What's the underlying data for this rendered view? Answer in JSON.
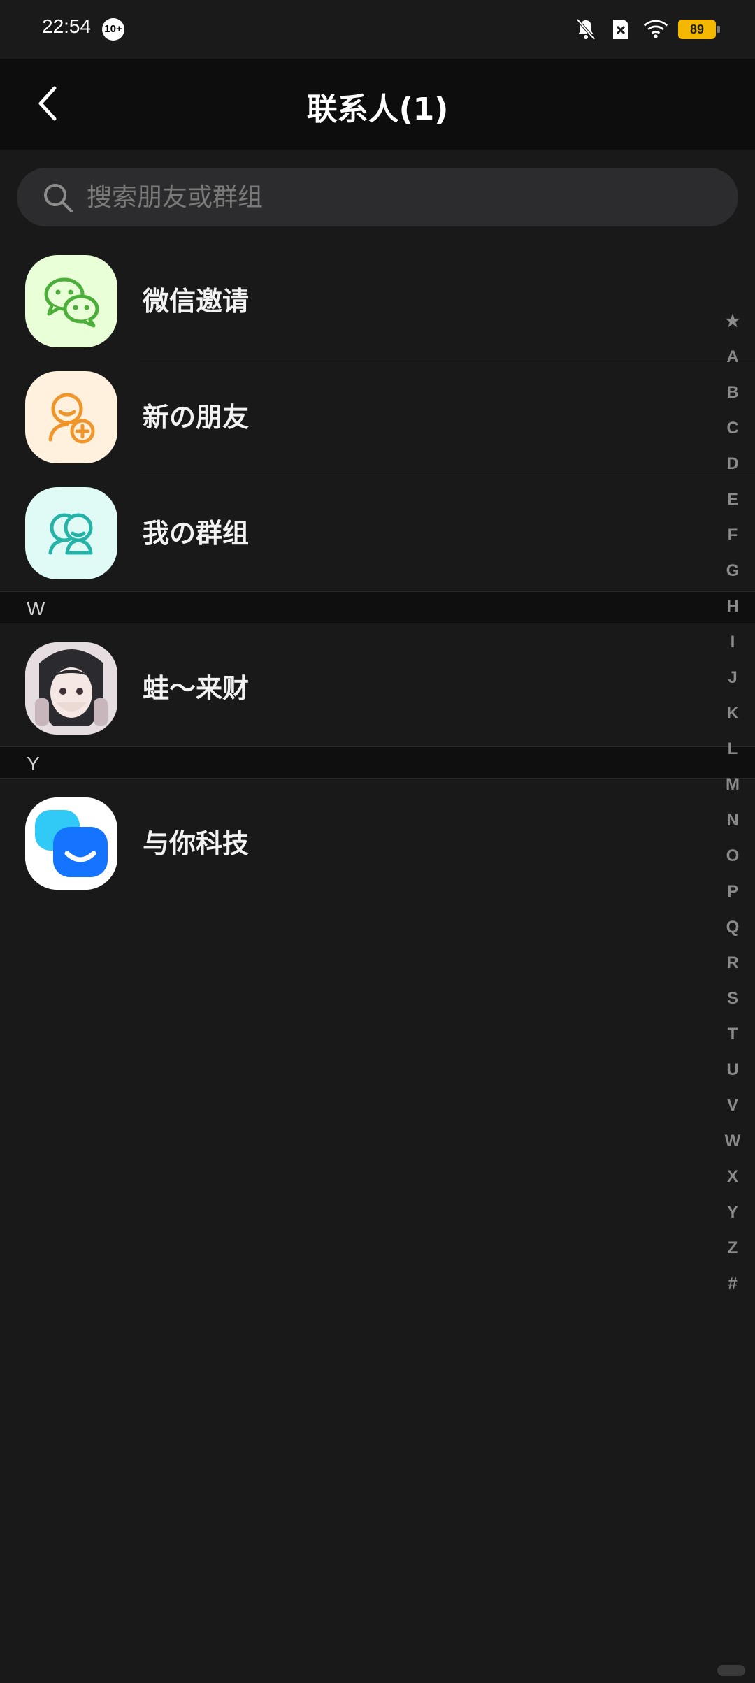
{
  "status_bar": {
    "time": "22:54",
    "notification_badge": "10+",
    "battery": "89",
    "icons": [
      "mute-bell-icon",
      "sim-x-icon",
      "wifi-icon",
      "battery-icon"
    ]
  },
  "header": {
    "title": "联系人(1)",
    "back_icon": "chevron-left-icon"
  },
  "search": {
    "placeholder": "搜索朋友或群组",
    "value": ""
  },
  "shortcuts": [
    {
      "label": "微信邀请",
      "icon": "wechat-icon",
      "color": "#4caf3a",
      "bg": "#e9ffd8"
    },
    {
      "label": "新の朋友",
      "icon": "add-friend-icon",
      "color": "#f0952a",
      "bg": "#fff1de"
    },
    {
      "label": "我の群组",
      "icon": "group-icon",
      "color": "#24b3a6",
      "bg": "#e0fbf6"
    }
  ],
  "sections": [
    {
      "letter": "W",
      "contacts": [
        {
          "name": "蛙～来财",
          "avatar": "anime-girl-avatar"
        }
      ]
    },
    {
      "letter": "Y",
      "contacts": [
        {
          "name": "与你科技",
          "avatar": "app-logo-avatar"
        }
      ]
    }
  ],
  "index_letters": [
    "★",
    "A",
    "B",
    "C",
    "D",
    "E",
    "F",
    "G",
    "H",
    "I",
    "J",
    "K",
    "L",
    "M",
    "N",
    "O",
    "P",
    "Q",
    "R",
    "S",
    "T",
    "U",
    "V",
    "W",
    "X",
    "Y",
    "Z",
    "#"
  ]
}
